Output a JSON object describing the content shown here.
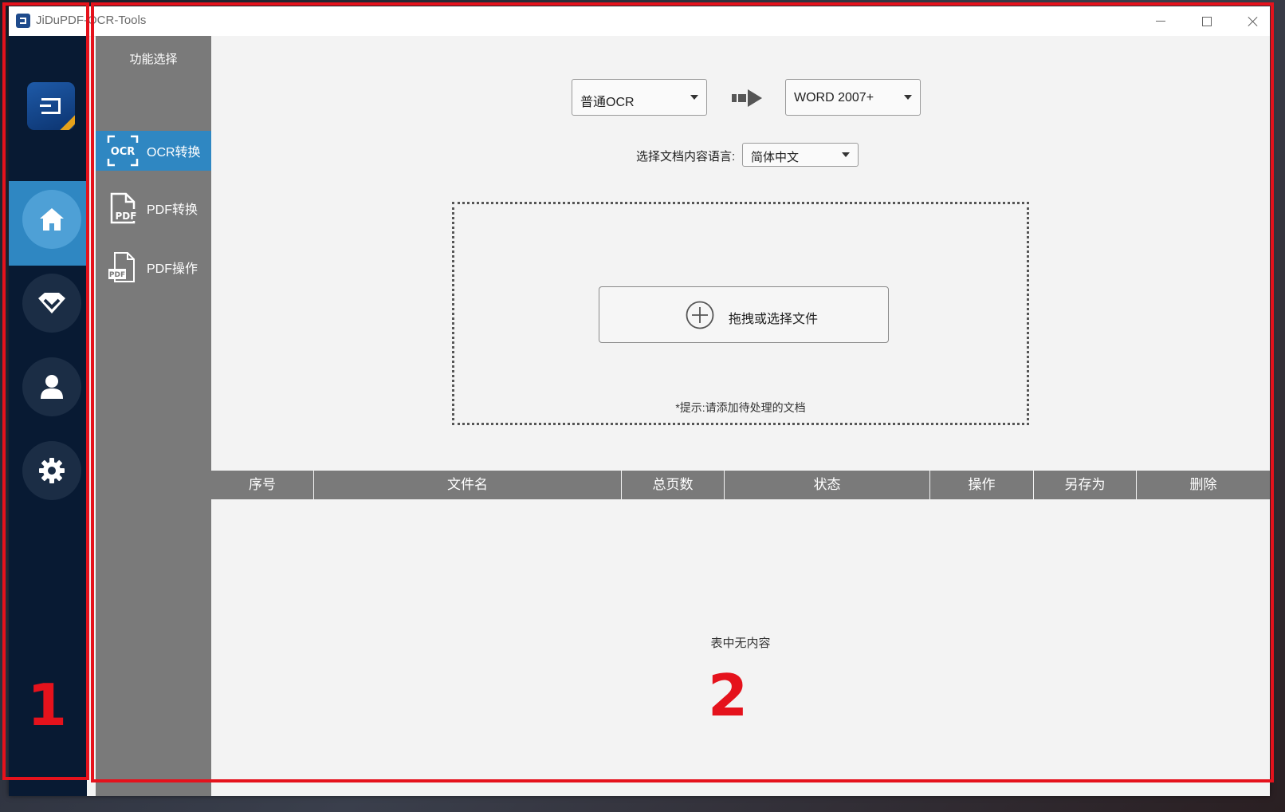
{
  "window": {
    "title": "JiDuPDF-OCR-Tools"
  },
  "rail": {
    "items": [
      {
        "name": "home",
        "icon": "home-icon",
        "active": true
      },
      {
        "name": "vip",
        "icon": "diamond-icon",
        "active": false
      },
      {
        "name": "user",
        "icon": "user-icon",
        "active": false
      },
      {
        "name": "settings",
        "icon": "gear-icon",
        "active": false
      }
    ]
  },
  "func_panel": {
    "title": "功能选择",
    "items": [
      {
        "label": "OCR转换",
        "icon": "ocr-scan-icon",
        "active": true
      },
      {
        "label": "PDF转换",
        "icon": "pdf-file-icon",
        "active": false
      },
      {
        "label": "PDF操作",
        "icon": "pdf-document-icon",
        "active": false
      }
    ]
  },
  "main": {
    "mode_select": "普通OCR",
    "format_select": "WORD 2007+",
    "language_label": "选择文档内容语言:",
    "language_select": "简体中文",
    "drop_button": "拖拽或选择文件",
    "drop_hint": "*提示:请添加待处理的文档",
    "table": {
      "columns": [
        "序号",
        "文件名",
        "总页数",
        "状态",
        "操作",
        "另存为",
        "删除"
      ],
      "empty_text": "表中无内容"
    }
  },
  "annotations": [
    "1",
    "2"
  ],
  "colors": {
    "accent": "#2f87c2",
    "rail_bg": "#081a33",
    "panel_bg": "#7a7a7a",
    "annotation": "#e5121c"
  }
}
